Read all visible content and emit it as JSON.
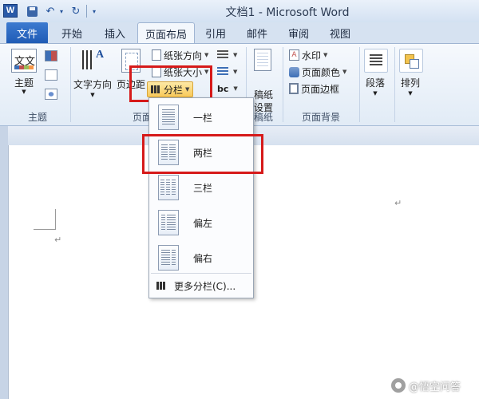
{
  "window": {
    "title": "文档1 - Microsoft Word",
    "logo_letter": "W"
  },
  "quick_access": {
    "save_icon": "save-icon",
    "undo_glyph": "↶",
    "redo_glyph": "↻",
    "dropdown_glyph": "▾"
  },
  "tabs": {
    "file": "文件",
    "items": [
      "开始",
      "插入",
      "页面布局",
      "引用",
      "邮件",
      "审阅",
      "视图"
    ],
    "active": "页面布局"
  },
  "ribbon": {
    "theme_group": {
      "label": "主题",
      "theme_button": "主题",
      "theme_icon_text": "文文"
    },
    "page_setup_group": {
      "label": "页面设置",
      "text_direction": "文字方向",
      "margins": "页边距",
      "orientation": "纸张方向",
      "size": "纸张大小",
      "columns": "分栏"
    },
    "manuscript_group": {
      "label": "稿纸",
      "manuscript_settings": "稿纸\n设置"
    },
    "page_background_group": {
      "label": "页面背景",
      "watermark": "水印",
      "page_color": "页面颜色",
      "page_border": "页面边框"
    },
    "paragraph": "段落",
    "arrange": "排列"
  },
  "columns_menu": {
    "items": [
      {
        "label": "一栏",
        "columns": 1
      },
      {
        "label": "两栏",
        "columns": 2
      },
      {
        "label": "三栏",
        "columns": 3
      },
      {
        "label": "偏左",
        "columns": 2
      },
      {
        "label": "偏右",
        "columns": 2
      }
    ],
    "more": "更多分栏(C)..."
  },
  "document": {
    "paragraph_mark": "↵"
  },
  "watermark_text": "@悟空问答",
  "colors": {
    "file_tab": "#1f5bb5",
    "highlight_red": "#d61a1a",
    "ribbon_bg": "#e1ebf6",
    "split_button": "#f8c95a"
  }
}
